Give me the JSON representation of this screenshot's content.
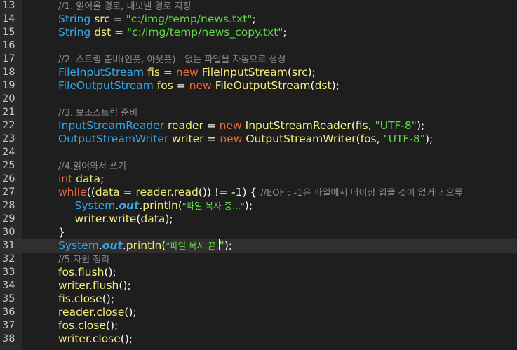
{
  "editor": {
    "lines": [
      {
        "n": "13",
        "indent": 2,
        "tokens": [
          {
            "t": "c",
            "v": "//1. 읽어올 경로, 내보낼 경로 지정"
          }
        ]
      },
      {
        "n": "14",
        "indent": 2,
        "tokens": [
          {
            "t": "t",
            "v": "String"
          },
          {
            "t": "v",
            "v": " src"
          },
          {
            "t": "p",
            "v": " = "
          },
          {
            "t": "s",
            "v": "\"c:/img/temp/news.txt\""
          },
          {
            "t": "p",
            "v": ";"
          }
        ]
      },
      {
        "n": "15",
        "indent": 2,
        "tokens": [
          {
            "t": "t",
            "v": "String"
          },
          {
            "t": "v",
            "v": " dst"
          },
          {
            "t": "p",
            "v": " = "
          },
          {
            "t": "s",
            "v": "\"c:/img/temp/news_copy.txt\""
          },
          {
            "t": "p",
            "v": ";"
          }
        ]
      },
      {
        "n": "16",
        "indent": 0,
        "tokens": []
      },
      {
        "n": "17",
        "indent": 2,
        "tokens": [
          {
            "t": "c",
            "v": "//2. 스트림 준비(인풋, 아웃풋) - 없는 파일을 자동으로 생성"
          }
        ]
      },
      {
        "n": "18",
        "indent": 2,
        "tokens": [
          {
            "t": "t",
            "v": "FileInputStream"
          },
          {
            "t": "v",
            "v": " fis"
          },
          {
            "t": "p",
            "v": " = "
          },
          {
            "t": "k",
            "v": "new"
          },
          {
            "t": "m",
            "v": " FileInputStream"
          },
          {
            "t": "p",
            "v": "("
          },
          {
            "t": "v",
            "v": "src"
          },
          {
            "t": "p",
            "v": ");"
          }
        ]
      },
      {
        "n": "19",
        "indent": 2,
        "tokens": [
          {
            "t": "t",
            "v": "FileOutputStream"
          },
          {
            "t": "v",
            "v": " fos"
          },
          {
            "t": "p",
            "v": " = "
          },
          {
            "t": "k",
            "v": "new"
          },
          {
            "t": "m",
            "v": " FileOutputStream"
          },
          {
            "t": "p",
            "v": "("
          },
          {
            "t": "v",
            "v": "dst"
          },
          {
            "t": "p",
            "v": ");"
          }
        ]
      },
      {
        "n": "20",
        "indent": 0,
        "tokens": []
      },
      {
        "n": "21",
        "indent": 2,
        "tokens": [
          {
            "t": "c",
            "v": "//3. 보조스트림 준비"
          }
        ]
      },
      {
        "n": "22",
        "indent": 2,
        "tokens": [
          {
            "t": "t",
            "v": "InputStreamReader"
          },
          {
            "t": "v",
            "v": " reader"
          },
          {
            "t": "p",
            "v": " = "
          },
          {
            "t": "k",
            "v": "new"
          },
          {
            "t": "m",
            "v": " InputStreamReader"
          },
          {
            "t": "p",
            "v": "("
          },
          {
            "t": "v",
            "v": "fis"
          },
          {
            "t": "p",
            "v": ", "
          },
          {
            "t": "s",
            "v": "\"UTF-8\""
          },
          {
            "t": "p",
            "v": ");"
          }
        ]
      },
      {
        "n": "23",
        "indent": 2,
        "tokens": [
          {
            "t": "t",
            "v": "OutputStreamWriter"
          },
          {
            "t": "v",
            "v": " writer"
          },
          {
            "t": "p",
            "v": " = "
          },
          {
            "t": "k",
            "v": "new"
          },
          {
            "t": "m",
            "v": " OutputStreamWriter"
          },
          {
            "t": "p",
            "v": "("
          },
          {
            "t": "v",
            "v": "fos"
          },
          {
            "t": "p",
            "v": ", "
          },
          {
            "t": "s",
            "v": "\"UTF-8\""
          },
          {
            "t": "p",
            "v": ");"
          }
        ]
      },
      {
        "n": "24",
        "indent": 0,
        "tokens": []
      },
      {
        "n": "25",
        "indent": 2,
        "tokens": [
          {
            "t": "c",
            "v": "//4.읽어와서 쓰기"
          }
        ]
      },
      {
        "n": "26",
        "indent": 2,
        "tokens": [
          {
            "t": "k",
            "v": "int"
          },
          {
            "t": "v",
            "v": " data"
          },
          {
            "t": "p",
            "v": ";"
          }
        ]
      },
      {
        "n": "27",
        "indent": 2,
        "tokens": [
          {
            "t": "k",
            "v": "while"
          },
          {
            "t": "p",
            "v": "(("
          },
          {
            "t": "v",
            "v": "data"
          },
          {
            "t": "p",
            "v": " = "
          },
          {
            "t": "v",
            "v": "reader"
          },
          {
            "t": "p",
            "v": "."
          },
          {
            "t": "m",
            "v": "read"
          },
          {
            "t": "p",
            "v": "()) != -1) { "
          },
          {
            "t": "c",
            "v": "//EOF : -1은 파일에서 더이상 읽을 것이 없거나 오류"
          }
        ]
      },
      {
        "n": "28",
        "indent": 3,
        "tokens": [
          {
            "t": "t",
            "v": "System"
          },
          {
            "t": "p",
            "v": "."
          },
          {
            "t": "f",
            "v": "out"
          },
          {
            "t": "p",
            "v": "."
          },
          {
            "t": "m",
            "v": "println"
          },
          {
            "t": "p",
            "v": "("
          },
          {
            "t": "s",
            "v": "\"파일 복사 중...\""
          },
          {
            "t": "p",
            "v": ");"
          }
        ]
      },
      {
        "n": "29",
        "indent": 3,
        "tokens": [
          {
            "t": "v",
            "v": "writer"
          },
          {
            "t": "p",
            "v": "."
          },
          {
            "t": "m",
            "v": "write"
          },
          {
            "t": "p",
            "v": "("
          },
          {
            "t": "v",
            "v": "data"
          },
          {
            "t": "p",
            "v": ");"
          }
        ]
      },
      {
        "n": "30",
        "indent": 2,
        "tokens": [
          {
            "t": "p",
            "v": "}"
          }
        ]
      },
      {
        "n": "31",
        "indent": 2,
        "current": true,
        "tokens": [
          {
            "t": "t",
            "v": "System"
          },
          {
            "t": "p",
            "v": "."
          },
          {
            "t": "f",
            "v": "out"
          },
          {
            "t": "p",
            "v": "."
          },
          {
            "t": "m",
            "v": "println"
          },
          {
            "t": "p",
            "v": "("
          },
          {
            "t": "s",
            "v": "\"파일 복사 끝."
          },
          {
            "t": "caret",
            "v": ""
          },
          {
            "t": "s",
            "v": "\""
          },
          {
            "t": "p",
            "v": ");"
          }
        ]
      },
      {
        "n": "32",
        "indent": 2,
        "tokens": [
          {
            "t": "c",
            "v": "//5.자원 정리"
          }
        ]
      },
      {
        "n": "33",
        "indent": 2,
        "tokens": [
          {
            "t": "v",
            "v": "fos"
          },
          {
            "t": "p",
            "v": "."
          },
          {
            "t": "m",
            "v": "flush"
          },
          {
            "t": "p",
            "v": "();"
          }
        ]
      },
      {
        "n": "34",
        "indent": 2,
        "tokens": [
          {
            "t": "v",
            "v": "writer"
          },
          {
            "t": "p",
            "v": "."
          },
          {
            "t": "m",
            "v": "flush"
          },
          {
            "t": "p",
            "v": "();"
          }
        ]
      },
      {
        "n": "35",
        "indent": 2,
        "tokens": [
          {
            "t": "v",
            "v": "fis"
          },
          {
            "t": "p",
            "v": "."
          },
          {
            "t": "m",
            "v": "close"
          },
          {
            "t": "p",
            "v": "();"
          }
        ]
      },
      {
        "n": "36",
        "indent": 2,
        "tokens": [
          {
            "t": "v",
            "v": "reader"
          },
          {
            "t": "p",
            "v": "."
          },
          {
            "t": "m",
            "v": "close"
          },
          {
            "t": "p",
            "v": "();"
          }
        ]
      },
      {
        "n": "37",
        "indent": 2,
        "tokens": [
          {
            "t": "v",
            "v": "fos"
          },
          {
            "t": "p",
            "v": "."
          },
          {
            "t": "m",
            "v": "close"
          },
          {
            "t": "p",
            "v": "();"
          }
        ]
      },
      {
        "n": "38",
        "indent": 2,
        "tokens": [
          {
            "t": "v",
            "v": "writer"
          },
          {
            "t": "p",
            "v": "."
          },
          {
            "t": "m",
            "v": "close"
          },
          {
            "t": "p",
            "v": "();"
          }
        ]
      }
    ]
  }
}
